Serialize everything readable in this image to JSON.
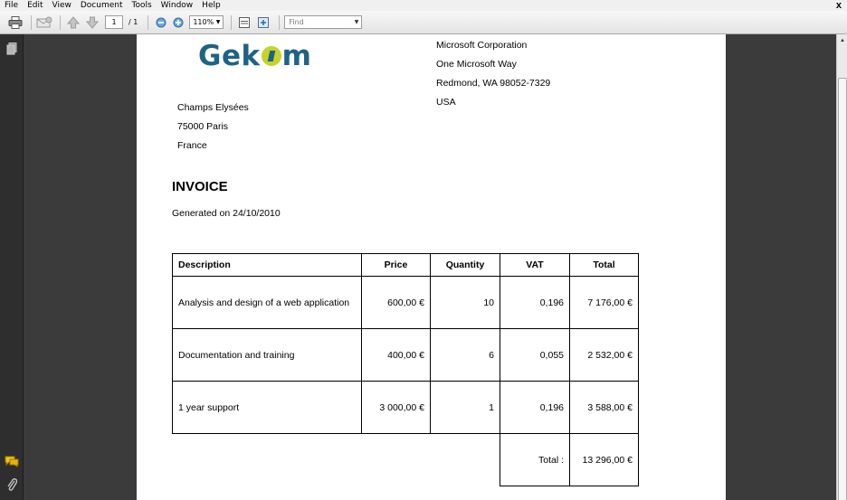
{
  "menu": [
    "File",
    "Edit",
    "View",
    "Document",
    "Tools",
    "Window",
    "Help"
  ],
  "window_close": "x",
  "toolbar": {
    "page_current": "1",
    "page_total": "/ 1",
    "zoom": "110%",
    "find_placeholder": "Find"
  },
  "invoice": {
    "logo_text_left": "Gek",
    "logo_text_right": "m",
    "recipient_address": [
      "Microsoft Corporation",
      "One Microsoft Way",
      "Redmond, WA 98052-7329",
      "USA"
    ],
    "sender_address": [
      "Champs Elysées",
      "75000 Paris",
      "France"
    ],
    "title": "INVOICE",
    "generated": "Generated on 24/10/2010",
    "columns": [
      "Description",
      "Price",
      "Quantity",
      "VAT",
      "Total"
    ],
    "rows": [
      [
        "Analysis and design of a web application",
        "600,00 €",
        "10",
        "0,196",
        "7 176,00 €"
      ],
      [
        "Documentation and training",
        "400,00 €",
        "6",
        "0,055",
        "2 532,00 €"
      ],
      [
        "1 year support",
        "3 000,00 €",
        "1",
        "0,196",
        "3 588,00 €"
      ]
    ],
    "grand_total_label": "Total :",
    "grand_total_value": "13 296,00 €"
  },
  "icons": {
    "print": "printer-icon",
    "email": "email-icon",
    "prev_page": "arrow-up-icon",
    "next_page": "arrow-down-icon",
    "zoom_out": "zoom-out-icon",
    "zoom_in": "zoom-in-icon",
    "fit_width": "fit-width-icon",
    "fit_page": "fit-page-icon",
    "pages_panel": "pages-icon",
    "comments": "comments-icon",
    "attachments": "paperclip-icon"
  },
  "colors": {
    "logo_blue": "#1e6385",
    "logo_lime": "#c6d329",
    "viewer_bg": "#3b3b3b"
  }
}
